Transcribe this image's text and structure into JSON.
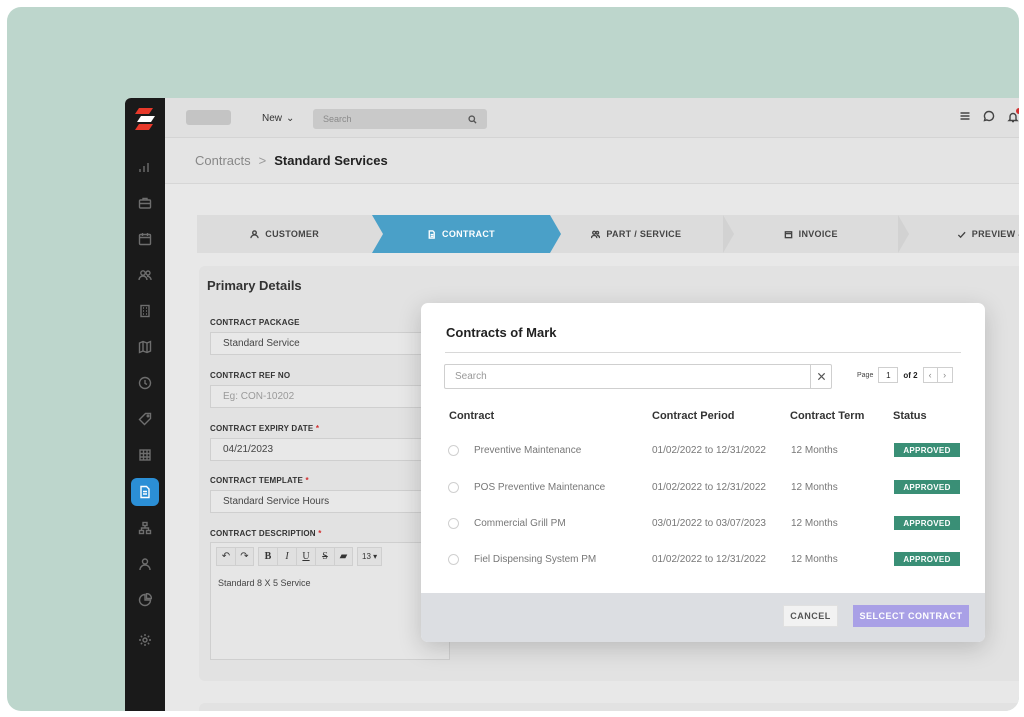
{
  "topbar": {
    "new_label": "New",
    "search_placeholder": "Search"
  },
  "breadcrumb": {
    "parent": "Contracts",
    "separator": ">",
    "current": "Standard Services"
  },
  "steps": [
    {
      "label": "CUSTOMER",
      "icon": "user-icon"
    },
    {
      "label": "CONTRACT",
      "icon": "document-icon",
      "active": true
    },
    {
      "label": "PART / SERVICE",
      "icon": "users-icon"
    },
    {
      "label": "INVOICE",
      "icon": "invoice-icon"
    },
    {
      "label": "PREVIEW &",
      "icon": "check-icon"
    }
  ],
  "primary": {
    "title": "Primary Details",
    "package_label": "CONTRACT PACKAGE",
    "package_value": "Standard Service",
    "ref_label": "CONTRACT REF NO",
    "ref_placeholder": "Eg: CON-10202",
    "expiry_label": "CONTRACT EXPIRY DATE",
    "expiry_value": "04/21/2023",
    "template_label": "CONTRACT TEMPLATE",
    "template_value": "Standard Service Hours",
    "description_label": "CONTRACT DESCRIPTION",
    "description_value": "Standard 8 X 5 Service",
    "required_mark": "*",
    "font_size": "13 ▾"
  },
  "modal": {
    "title": "Contracts of Mark",
    "search_placeholder": "Search",
    "page_label": "Page",
    "page_current": "1",
    "page_of": "of 2",
    "prev": "‹",
    "next": "›",
    "columns": [
      "Contract",
      "Contract Period",
      "Contract Term",
      "Status"
    ],
    "rows": [
      {
        "contract": "Preventive Maintenance",
        "period": "01/02/2022 to 12/31/2022",
        "term": "12 Months",
        "status": "APPROVED"
      },
      {
        "contract": "POS Preventive Maintenance",
        "period": "01/02/2022 to 12/31/2022",
        "term": "12 Months",
        "status": "APPROVED"
      },
      {
        "contract": "Commercial Grill PM",
        "period": "03/01/2022 to 03/07/2023",
        "term": "12 Months",
        "status": "APPROVED"
      },
      {
        "contract": "Fiel Dispensing System PM",
        "period": "01/02/2022 to 12/31/2022",
        "term": "12 Months",
        "status": "APPROVED"
      }
    ],
    "cancel_label": "CANCEL",
    "select_label": "SELCECT CONTRACT"
  },
  "colors": {
    "accent": "#4aa0c8",
    "sidebar_active": "#2b8fd6",
    "approved": "#3a8f76",
    "primary_button": "#a9a0e6",
    "background": "#bdd6cc"
  }
}
